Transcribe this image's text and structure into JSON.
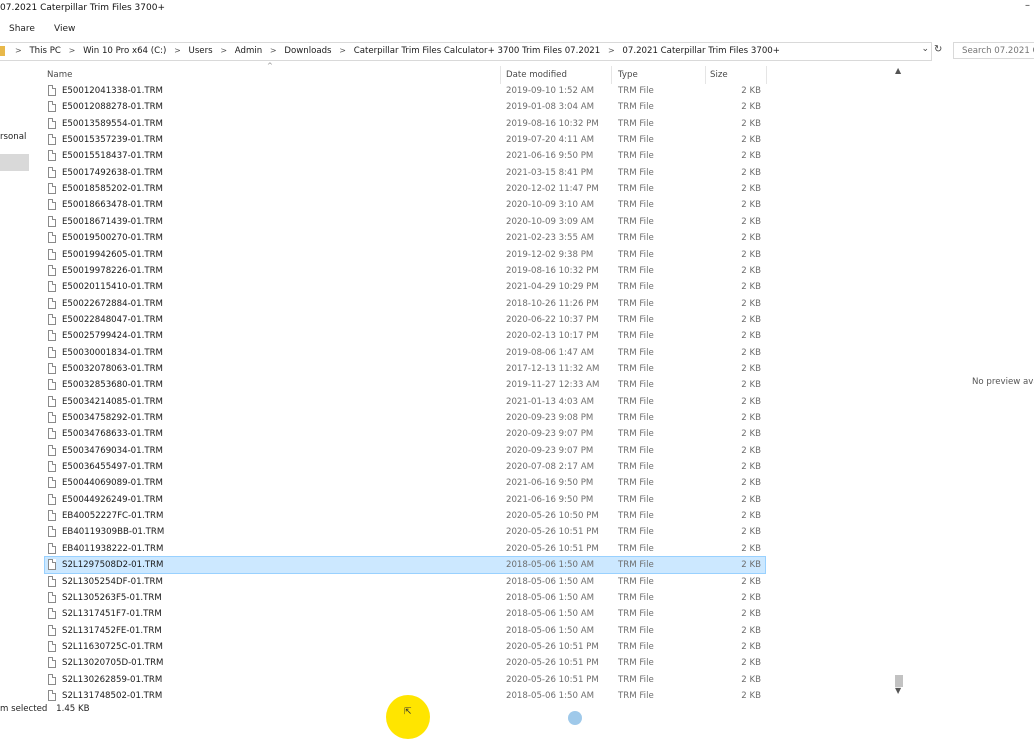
{
  "window": {
    "title": "07.2021 Caterpillar Trim Files 3700+",
    "minimize_glyph": "–"
  },
  "ribbon": {
    "tabs": [
      "Share",
      "View"
    ]
  },
  "address": {
    "breadcrumbs": [
      "This PC",
      "Win 10 Pro x64 (C:)",
      "Users",
      "Admin",
      "Downloads",
      "Caterpillar Trim Files Calculator+ 3700 Trim Files 07.2021",
      "07.2021 Caterpillar Trim Files 3700+"
    ],
    "separator": ">",
    "dropdown_glyph": "⌄",
    "refresh_glyph": "↻",
    "search_placeholder": "Search 07.2021 Ca"
  },
  "navigation": {
    "partial_label": "rsonal"
  },
  "columns": {
    "name": "Name",
    "date": "Date modified",
    "type": "Type",
    "size": "Size",
    "sort_glyph": "^"
  },
  "files": [
    {
      "name": "E50012041338-01.TRM",
      "date": "2019-09-10 1:52 AM",
      "type": "TRM File",
      "size": "2 KB"
    },
    {
      "name": "E50012088278-01.TRM",
      "date": "2019-01-08 3:04 AM",
      "type": "TRM File",
      "size": "2 KB"
    },
    {
      "name": "E50013589554-01.TRM",
      "date": "2019-08-16 10:32 PM",
      "type": "TRM File",
      "size": "2 KB"
    },
    {
      "name": "E50015357239-01.TRM",
      "date": "2019-07-20 4:11 AM",
      "type": "TRM File",
      "size": "2 KB"
    },
    {
      "name": "E50015518437-01.TRM",
      "date": "2021-06-16 9:50 PM",
      "type": "TRM File",
      "size": "2 KB"
    },
    {
      "name": "E50017492638-01.TRM",
      "date": "2021-03-15 8:41 PM",
      "type": "TRM File",
      "size": "2 KB"
    },
    {
      "name": "E50018585202-01.TRM",
      "date": "2020-12-02 11:47 PM",
      "type": "TRM File",
      "size": "2 KB"
    },
    {
      "name": "E50018663478-01.TRM",
      "date": "2020-10-09 3:10 AM",
      "type": "TRM File",
      "size": "2 KB"
    },
    {
      "name": "E50018671439-01.TRM",
      "date": "2020-10-09 3:09 AM",
      "type": "TRM File",
      "size": "2 KB"
    },
    {
      "name": "E50019500270-01.TRM",
      "date": "2021-02-23 3:55 AM",
      "type": "TRM File",
      "size": "2 KB"
    },
    {
      "name": "E50019942605-01.TRM",
      "date": "2019-12-02 9:38 PM",
      "type": "TRM File",
      "size": "2 KB"
    },
    {
      "name": "E50019978226-01.TRM",
      "date": "2019-08-16 10:32 PM",
      "type": "TRM File",
      "size": "2 KB"
    },
    {
      "name": "E50020115410-01.TRM",
      "date": "2021-04-29 10:29 PM",
      "type": "TRM File",
      "size": "2 KB"
    },
    {
      "name": "E50022672884-01.TRM",
      "date": "2018-10-26 11:26 PM",
      "type": "TRM File",
      "size": "2 KB"
    },
    {
      "name": "E50022848047-01.TRM",
      "date": "2020-06-22 10:37 PM",
      "type": "TRM File",
      "size": "2 KB"
    },
    {
      "name": "E50025799424-01.TRM",
      "date": "2020-02-13 10:17 PM",
      "type": "TRM File",
      "size": "2 KB"
    },
    {
      "name": "E50030001834-01.TRM",
      "date": "2019-08-06 1:47 AM",
      "type": "TRM File",
      "size": "2 KB"
    },
    {
      "name": "E50032078063-01.TRM",
      "date": "2017-12-13 11:32 AM",
      "type": "TRM File",
      "size": "2 KB"
    },
    {
      "name": "E50032853680-01.TRM",
      "date": "2019-11-27 12:33 AM",
      "type": "TRM File",
      "size": "2 KB"
    },
    {
      "name": "E50034214085-01.TRM",
      "date": "2021-01-13 4:03 AM",
      "type": "TRM File",
      "size": "2 KB"
    },
    {
      "name": "E50034758292-01.TRM",
      "date": "2020-09-23 9:08 PM",
      "type": "TRM File",
      "size": "2 KB"
    },
    {
      "name": "E50034768633-01.TRM",
      "date": "2020-09-23 9:07 PM",
      "type": "TRM File",
      "size": "2 KB"
    },
    {
      "name": "E50034769034-01.TRM",
      "date": "2020-09-23 9:07 PM",
      "type": "TRM File",
      "size": "2 KB"
    },
    {
      "name": "E50036455497-01.TRM",
      "date": "2020-07-08 2:17 AM",
      "type": "TRM File",
      "size": "2 KB"
    },
    {
      "name": "E50044069089-01.TRM",
      "date": "2021-06-16 9:50 PM",
      "type": "TRM File",
      "size": "2 KB"
    },
    {
      "name": "E50044926249-01.TRM",
      "date": "2021-06-16 9:50 PM",
      "type": "TRM File",
      "size": "2 KB"
    },
    {
      "name": "EB40052227FC-01.TRM",
      "date": "2020-05-26 10:50 PM",
      "type": "TRM File",
      "size": "2 KB"
    },
    {
      "name": "EB40119309BB-01.TRM",
      "date": "2020-05-26 10:51 PM",
      "type": "TRM File",
      "size": "2 KB"
    },
    {
      "name": "EB4011938222-01.TRM",
      "date": "2020-05-26 10:51 PM",
      "type": "TRM File",
      "size": "2 KB"
    },
    {
      "name": "S2L1297508D2-01.TRM",
      "date": "2018-05-06 1:50 AM",
      "type": "TRM File",
      "size": "2 KB",
      "selected": true
    },
    {
      "name": "S2L1305254DF-01.TRM",
      "date": "2018-05-06 1:50 AM",
      "type": "TRM File",
      "size": "2 KB"
    },
    {
      "name": "S2L1305263F5-01.TRM",
      "date": "2018-05-06 1:50 AM",
      "type": "TRM File",
      "size": "2 KB"
    },
    {
      "name": "S2L1317451F7-01.TRM",
      "date": "2018-05-06 1:50 AM",
      "type": "TRM File",
      "size": "2 KB"
    },
    {
      "name": "S2L1317452FE-01.TRM",
      "date": "2018-05-06 1:50 AM",
      "type": "TRM File",
      "size": "2 KB"
    },
    {
      "name": "S2L11630725C-01.TRM",
      "date": "2020-05-26 10:51 PM",
      "type": "TRM File",
      "size": "2 KB"
    },
    {
      "name": "S2L13020705D-01.TRM",
      "date": "2020-05-26 10:51 PM",
      "type": "TRM File",
      "size": "2 KB"
    },
    {
      "name": "S2L130262859-01.TRM",
      "date": "2020-05-26 10:51 PM",
      "type": "TRM File",
      "size": "2 KB"
    },
    {
      "name": "S2L131748502-01.TRM",
      "date": "2018-05-06 1:50 AM",
      "type": "TRM File",
      "size": "2 KB"
    }
  ],
  "scrollbar": {
    "up_glyph": "▲",
    "down_glyph": "▼"
  },
  "preview": {
    "message": "No preview ava"
  },
  "status": {
    "selected_text": "m selected",
    "selected_size": "1.45 KB"
  },
  "cursor": {
    "glyph": "⇱"
  },
  "colors": {
    "selection_fill": "#cce8ff",
    "selection_border": "#99d1ff",
    "cursor_highlight": "#ffe500"
  }
}
